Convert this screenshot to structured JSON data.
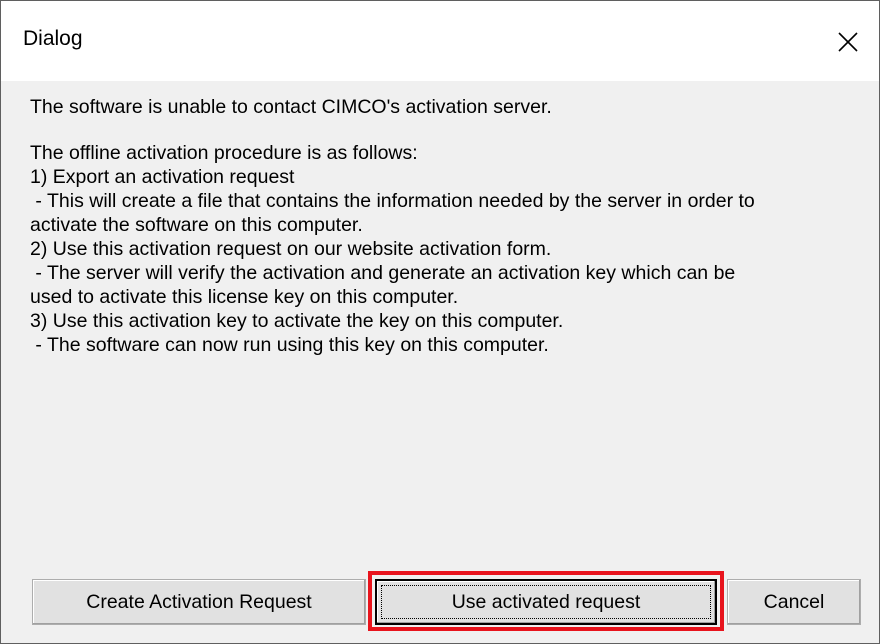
{
  "window": {
    "title": "Dialog"
  },
  "message": {
    "lines": [
      "The software is unable to contact CIMCO's activation server.",
      "",
      "The offline activation procedure is as follows:",
      "1) Export an activation request",
      " - This will create a file that contains the information needed by the server in order to",
      "activate the software on this computer.",
      "2) Use this activation request on our website activation form.",
      " - The server will verify the activation and generate an activation key which can be",
      "used to activate this license key on this computer.",
      "3) Use this activation key to activate the key on this computer.",
      " - The software can now run using this key on this computer."
    ]
  },
  "buttons": {
    "create_label": "Create Activation Request",
    "use_label": "Use activated request",
    "cancel_label": "Cancel"
  },
  "icons": {
    "close": "close-icon"
  },
  "colors": {
    "highlight": "#e8141d",
    "dialog_bg": "#f0f0f0",
    "button_bg": "#e1e1e1"
  }
}
